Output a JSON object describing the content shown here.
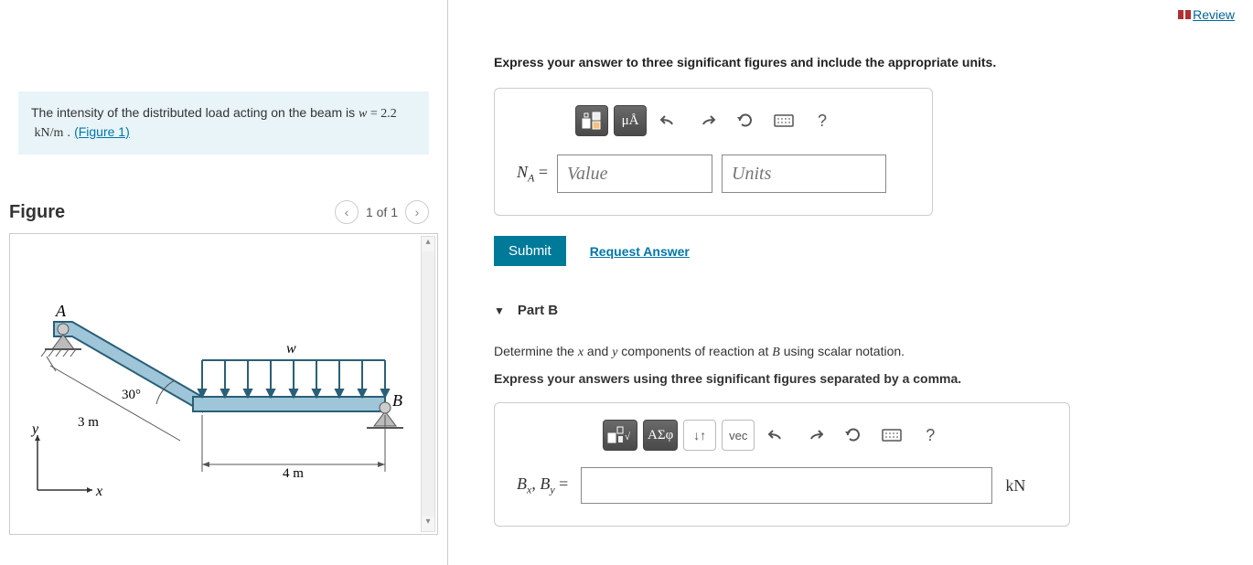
{
  "review": {
    "label": "Review"
  },
  "problem": {
    "text_before": "The intensity of the distributed load acting on the beam is ",
    "variable": "w",
    "equals": " = ",
    "value": "2.2",
    "unit": "kN/m",
    "after": " . ",
    "figure_link": "(Figure 1)"
  },
  "figure": {
    "title": "Figure",
    "nav": "1 of 1",
    "labels": {
      "A": "A",
      "B": "B",
      "w": "w",
      "angle": "30°",
      "len1": "3 m",
      "len2": "4 m",
      "x": "x",
      "y": "y"
    }
  },
  "partA": {
    "instruction": "Express your answer to three significant figures and include the appropriate units.",
    "toolbar": {
      "units_tool": "μÅ",
      "help": "?"
    },
    "lhs": "N",
    "lhs_sub": "A",
    "equals": " = ",
    "value_placeholder": "Value",
    "units_placeholder": "Units",
    "submit": "Submit",
    "request": "Request Answer"
  },
  "partB": {
    "header": "Part B",
    "text_before": "Determine the ",
    "var_x": "x",
    "text_mid1": " and ",
    "var_y": "y",
    "text_after": " components of reaction at ",
    "var_B": "B",
    "text_end": " using scalar notation.",
    "bold_line": "Express your answers using three significant figures separated by a comma.",
    "toolbar": {
      "greek": "ΑΣφ",
      "vec": "vec",
      "help": "?",
      "updown": "↓↑"
    },
    "lhs_Bx": "B",
    "lhs_Bx_sub": "x",
    "lhs_comma": ", ",
    "lhs_By": "B",
    "lhs_By_sub": "y",
    "equals": " = ",
    "unit": "kN"
  },
  "chart_data": {
    "type": "diagram",
    "title": "Bent beam with distributed load",
    "members": [
      {
        "from": "A",
        "to": "bend",
        "length_m": 3,
        "angle_deg_from_horizontal": -30
      },
      {
        "from": "bend",
        "to": "B",
        "length_m": 4,
        "angle_deg_from_horizontal": 0
      }
    ],
    "supports": {
      "A": "pin",
      "B": "roller"
    },
    "distributed_load": {
      "on": "bend-to-B",
      "intensity_kN_per_m": 2.2,
      "direction": "down",
      "symbol": "w"
    },
    "annotations": [
      "30°",
      "3 m",
      "4 m",
      "x",
      "y",
      "A",
      "B",
      "w"
    ]
  }
}
